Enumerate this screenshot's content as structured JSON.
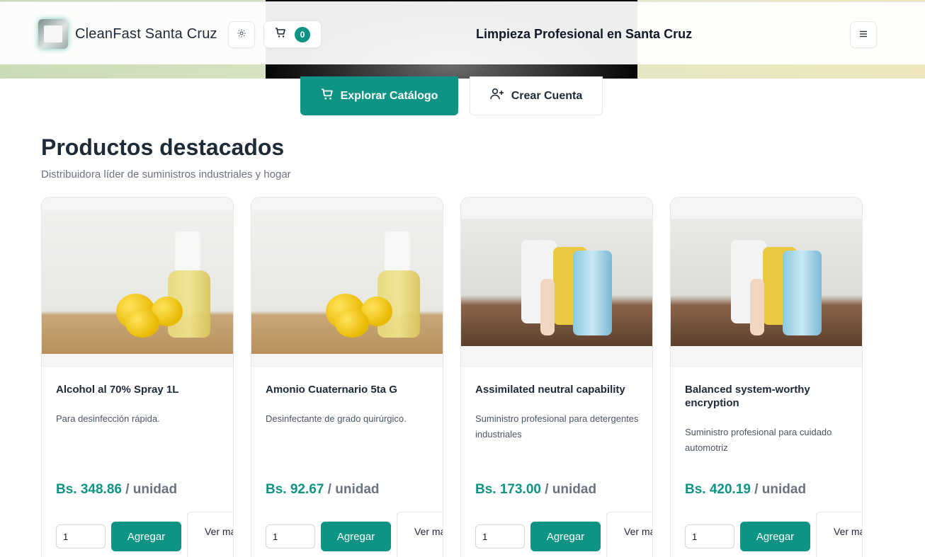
{
  "header": {
    "brand": "CleanFast Santa Cruz",
    "cart_count": "0",
    "title": "Limpieza Profesional en Santa Cruz",
    "icons": {
      "theme": "sun-icon",
      "cart": "cart-icon",
      "menu": "hamburger-icon"
    }
  },
  "cta": {
    "explore": "Explorar Catálogo",
    "create_account": "Crear Cuenta"
  },
  "section": {
    "title": "Productos destacados",
    "subtitle": "Distribuidora líder de suministros industriales y hogar"
  },
  "products": [
    {
      "name": "Alcohol al 70% Spray 1L",
      "description": "Para desinfección rápida.",
      "price": "Bs. 348.86",
      "unit": " / unidad",
      "qty": "1",
      "add_label": "Agregar",
      "more_label": "Ver más",
      "image": "lemon-spray-photo"
    },
    {
      "name": "Amonio Cuaternario 5ta G",
      "description": "Desinfectante de grado quirúrgico.",
      "price": "Bs. 92.67",
      "unit": " / unidad",
      "qty": "1",
      "add_label": "Agregar",
      "more_label": "Ver más",
      "image": "lemon-spray-photo"
    },
    {
      "name": "Assimilated neutral capability",
      "description": "Suministro profesional para detergentes industriales",
      "price": "Bs. 173.00",
      "unit": " / unidad",
      "qty": "1",
      "add_label": "Agregar",
      "more_label": "Ver más",
      "image": "cleaning-products-photo"
    },
    {
      "name": "Balanced system-worthy encryption",
      "description": "Suministro profesional para cuidado automotriz",
      "price": "Bs. 420.19",
      "unit": " / unidad",
      "qty": "1",
      "add_label": "Agregar",
      "more_label": "Ver más",
      "image": "cleaning-products-photo"
    }
  ],
  "colors": {
    "accent": "#0e9384",
    "text": "#1f2937",
    "muted": "#6b7280"
  }
}
